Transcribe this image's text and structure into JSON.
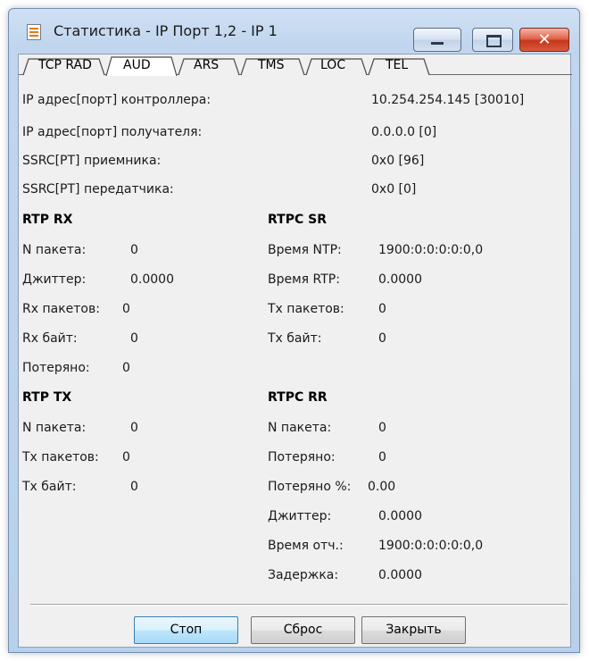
{
  "window": {
    "title": "Статистика - IP Порт 1,2 - IP 1",
    "close_glyph": "✕"
  },
  "tabs": [
    {
      "label": "TCP RAD",
      "active": false
    },
    {
      "label": "AUD",
      "active": true
    },
    {
      "label": "ARS",
      "active": false
    },
    {
      "label": "TMS",
      "active": false
    },
    {
      "label": "LOC",
      "active": false
    },
    {
      "label": "TEL",
      "active": false
    }
  ],
  "info": [
    {
      "label": "IP адрес[порт] контроллера:",
      "value": "10.254.254.145 [30010]"
    },
    {
      "label": "IP адрес[порт] получателя:",
      "value": "0.0.0.0 [0]"
    },
    {
      "label": "SSRC[PT] приемника:",
      "value": "0x0 [96]"
    },
    {
      "label": "SSRC[PT] передатчика:",
      "value": "0x0 [0]"
    }
  ],
  "rtp_rx": {
    "title": "RTP RX",
    "rows": [
      {
        "label": "N пакета:",
        "value": "0"
      },
      {
        "label": "Джиттер:",
        "value": "0.0000"
      },
      {
        "label": "Rx пакетов:",
        "value": "0"
      },
      {
        "label": "Rx байт:",
        "value": "0"
      },
      {
        "label": "Потеряно:",
        "value": "0"
      }
    ]
  },
  "rtpc_sr": {
    "title": "RTPC SR",
    "rows": [
      {
        "label": "Время NTP:",
        "value": "1900:0:0:0:0:0,0"
      },
      {
        "label": "Время RTP:",
        "value": "0.0000"
      },
      {
        "label": "Tx пакетов:",
        "value": "0"
      },
      {
        "label": "Tx байт:",
        "value": "0"
      }
    ]
  },
  "rtp_tx": {
    "title": "RTP TX",
    "rows": [
      {
        "label": "N пакета:",
        "value": "0"
      },
      {
        "label": "Tx пакетов:",
        "value": "0"
      },
      {
        "label": "Tx байт:",
        "value": "0"
      }
    ]
  },
  "rtpc_rr": {
    "title": "RTPC RR",
    "rows": [
      {
        "label": "N пакета:",
        "value": "0"
      },
      {
        "label": "Потеряно:",
        "value": "0"
      },
      {
        "label": "Потеряно %:",
        "value": "0.00"
      },
      {
        "label": "Джиттер:",
        "value": "0.0000"
      },
      {
        "label": "Время отч.:",
        "value": "1900:0:0:0:0:0,0"
      },
      {
        "label": "Задержка:",
        "value": "0.0000"
      }
    ]
  },
  "buttons": {
    "stop": "Стоп",
    "reset": "Сброс",
    "close": "Закрыть"
  }
}
